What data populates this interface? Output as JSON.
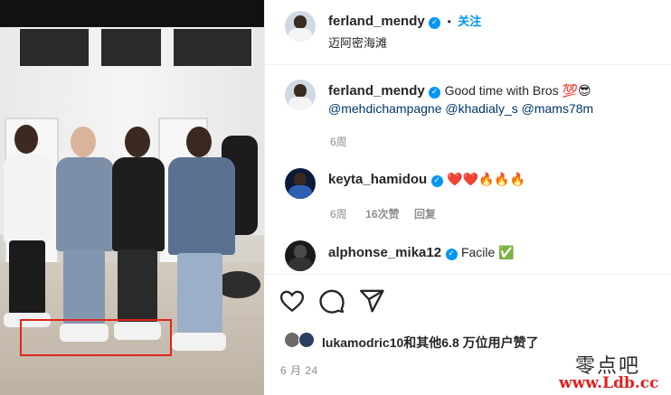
{
  "post_header": {
    "username": "ferland_mendy",
    "follow_label": "关注",
    "separator": "•",
    "location": "迈阿密海滩"
  },
  "caption": {
    "username": "ferland_mendy",
    "text": "Good time with Bros 💯😎",
    "mentions": "@mehdichampagne @khadialy_s @mams78m",
    "time": "6周"
  },
  "comments": [
    {
      "username": "keyta_hamidou",
      "text": "❤️❤️🔥🔥🔥",
      "time": "6周",
      "likes": "16次赞",
      "reply_label": "回复"
    },
    {
      "username": "alphonse_mika12",
      "text": "Facile ✅"
    }
  ],
  "likes": {
    "first_user": "lukamodric10",
    "rest_text": "和其他6.8 万位用户赞了"
  },
  "post_date": "6 月 24",
  "watermark": {
    "site_name": "零点吧",
    "url": "www.Ldb.cc"
  },
  "icons": {
    "like": "heart-icon",
    "comment": "comment-bubble-icon",
    "share": "paper-plane-icon",
    "verified": "verified-badge-icon"
  },
  "colors": {
    "link_blue": "#0095f6",
    "mention_navy": "#00376b",
    "muted_gray": "#8e8e8e",
    "highlight_red": "#e0261c"
  }
}
